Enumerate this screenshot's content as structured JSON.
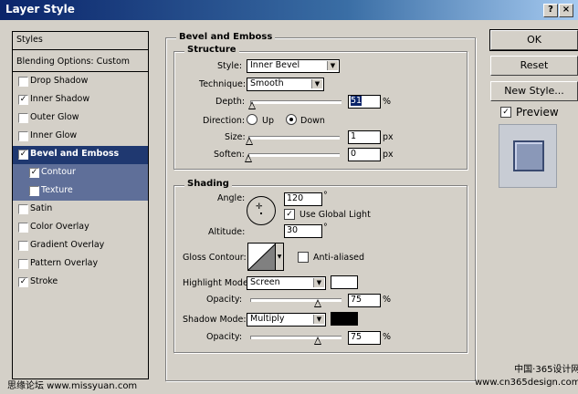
{
  "window": {
    "title": "Layer Style"
  },
  "styles_list": {
    "header": "Styles",
    "blending": "Blending Options: Custom",
    "items": [
      {
        "label": "Drop Shadow",
        "checked": false
      },
      {
        "label": "Inner Shadow",
        "checked": true
      },
      {
        "label": "Outer Glow",
        "checked": false
      },
      {
        "label": "Inner Glow",
        "checked": false
      },
      {
        "label": "Bevel and Emboss",
        "checked": true
      },
      {
        "label": "Contour",
        "checked": true
      },
      {
        "label": "Texture",
        "checked": false
      },
      {
        "label": "Satin",
        "checked": false
      },
      {
        "label": "Color Overlay",
        "checked": false
      },
      {
        "label": "Gradient Overlay",
        "checked": false
      },
      {
        "label": "Pattern Overlay",
        "checked": false
      },
      {
        "label": "Stroke",
        "checked": true
      }
    ]
  },
  "bevel": {
    "title": "Bevel and Emboss",
    "structure": {
      "title": "Structure",
      "style_label": "Style:",
      "style_value": "Inner Bevel",
      "technique_label": "Technique:",
      "technique_value": "Smooth",
      "depth_label": "Depth:",
      "depth_value": "51",
      "depth_unit": "%",
      "direction_label": "Direction:",
      "dir_up": "Up",
      "dir_down": "Down",
      "size_label": "Size:",
      "size_value": "1",
      "size_unit": "px",
      "soften_label": "Soften:",
      "soften_value": "0",
      "soften_unit": "px"
    },
    "shading": {
      "title": "Shading",
      "angle_label": "Angle:",
      "angle_value": "120",
      "angle_unit": "°",
      "global_light": "Use Global Light",
      "altitude_label": "Altitude:",
      "altitude_value": "30",
      "altitude_unit": "°",
      "gloss_label": "Gloss Contour:",
      "anti_aliased": "Anti-aliased",
      "highlight_label": "Highlight Mode:",
      "highlight_value": "Screen",
      "highlight_opacity_label": "Opacity:",
      "highlight_opacity": "75",
      "highlight_opacity_unit": "%",
      "shadow_label": "Shadow Mode:",
      "shadow_value": "Multiply",
      "shadow_opacity_label": "Opacity:",
      "shadow_opacity": "75",
      "shadow_opacity_unit": "%",
      "highlight_color": "#ffffff",
      "shadow_color": "#000000"
    }
  },
  "buttons": {
    "ok": "OK",
    "reset": "Reset",
    "new_style": "New Style...",
    "preview": "Preview"
  },
  "watermarks": {
    "left": "思缘论坛 www.missyuan.com",
    "right_line1": "中国·365设计网",
    "right_line2": "www.cn365design.com"
  }
}
